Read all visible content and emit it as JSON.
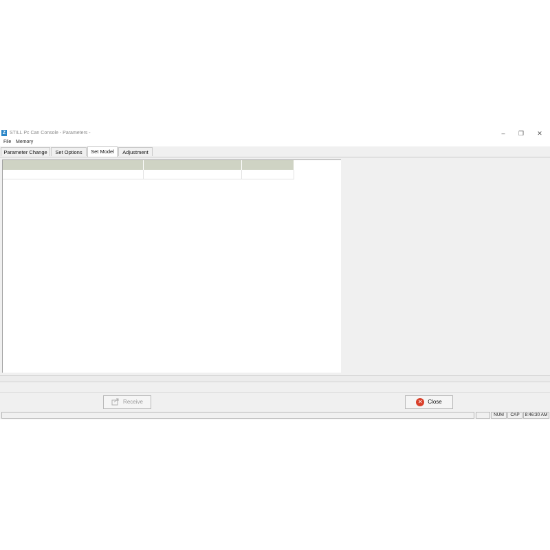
{
  "window": {
    "title": "STILL Pc Can Console - Parameters -",
    "app_icon_glyph": "Z",
    "controls": {
      "minimize": "–",
      "maximize": "❐",
      "close": "✕"
    }
  },
  "menu": {
    "items": [
      "File",
      "Memory"
    ]
  },
  "tabs": [
    {
      "label": "Parameter Change",
      "active": false
    },
    {
      "label": "Set Options",
      "active": false
    },
    {
      "label": "Set Model",
      "active": true
    },
    {
      "label": "Adjustment",
      "active": false
    }
  ],
  "grid": {
    "columns": [
      "",
      "",
      ""
    ],
    "rows": [
      [
        "",
        "",
        ""
      ]
    ]
  },
  "buttons": {
    "receive": {
      "label": "Receive",
      "enabled": false,
      "icon": "receive-icon"
    },
    "close": {
      "label": "Close",
      "enabled": true,
      "icon": "close-x-icon"
    }
  },
  "statusbar": {
    "main": "",
    "empty": "",
    "num": "NUM",
    "cap": "CAP",
    "time": "8:46:30 AM"
  },
  "colors": {
    "header_bg": "#cfd3c4",
    "close_icon": "#d9402b",
    "app_icon": "#2a86c8"
  }
}
